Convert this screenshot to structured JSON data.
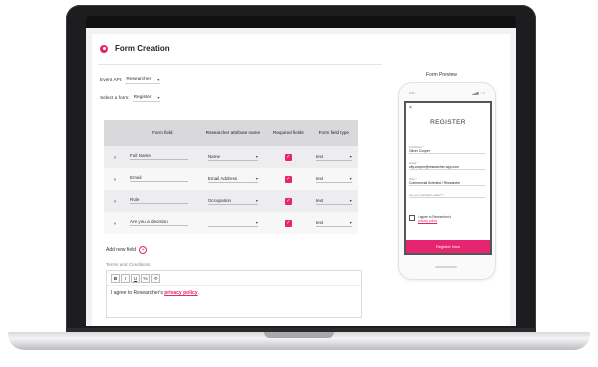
{
  "app": {
    "title": "Form Creation",
    "event_api": {
      "label": "Event API:",
      "value": "Researcher"
    },
    "select_form": {
      "label": "Select a form:",
      "value": "Register"
    }
  },
  "table": {
    "headers": [
      "Form field",
      "Researcher attribute name",
      "Required fields",
      "Form field type"
    ],
    "rows": [
      {
        "field": "Full Name",
        "attribute": "Name",
        "required": true,
        "type": "text"
      },
      {
        "field": "Email",
        "attribute": "Email Address",
        "required": true,
        "type": "text"
      },
      {
        "field": "Role",
        "attribute": "Occupation",
        "required": true,
        "type": "text"
      },
      {
        "field": "Are you a decision",
        "attribute": "",
        "required": true,
        "type": "text"
      }
    ],
    "add_new_label": "Add new field"
  },
  "terms": {
    "label": "Terms and Conditions",
    "toolbar": [
      "B",
      "I",
      "U",
      "%",
      "⟲"
    ],
    "text_before": "I agree to Researcher's ",
    "link": "privacy policy",
    "text_after": "."
  },
  "preview": {
    "label": "Form Preview",
    "status_time": "9:41",
    "status_icons": "▂▄▆ ◔ ▭",
    "close": "×",
    "heading": "REGISTER",
    "fields": [
      {
        "label": "Full Name *",
        "value": "Oliver Cooper"
      },
      {
        "label": "Email *",
        "value": "olly.cooper@researcher-app.com"
      },
      {
        "label": "Role *",
        "value": "Commercial Scientist / Researche"
      },
      {
        "label": "Are you a decision maker? *",
        "value": ""
      }
    ],
    "consent_text": "I agree to Researcher's",
    "consent_link": "privacy policy",
    "button": "Register Now"
  },
  "colors": {
    "accent": "#e6246f",
    "header_bg": "#d9d9dc"
  },
  "icons": {
    "remove": "×",
    "caret": "▾",
    "check": "✓",
    "plus": "+"
  }
}
